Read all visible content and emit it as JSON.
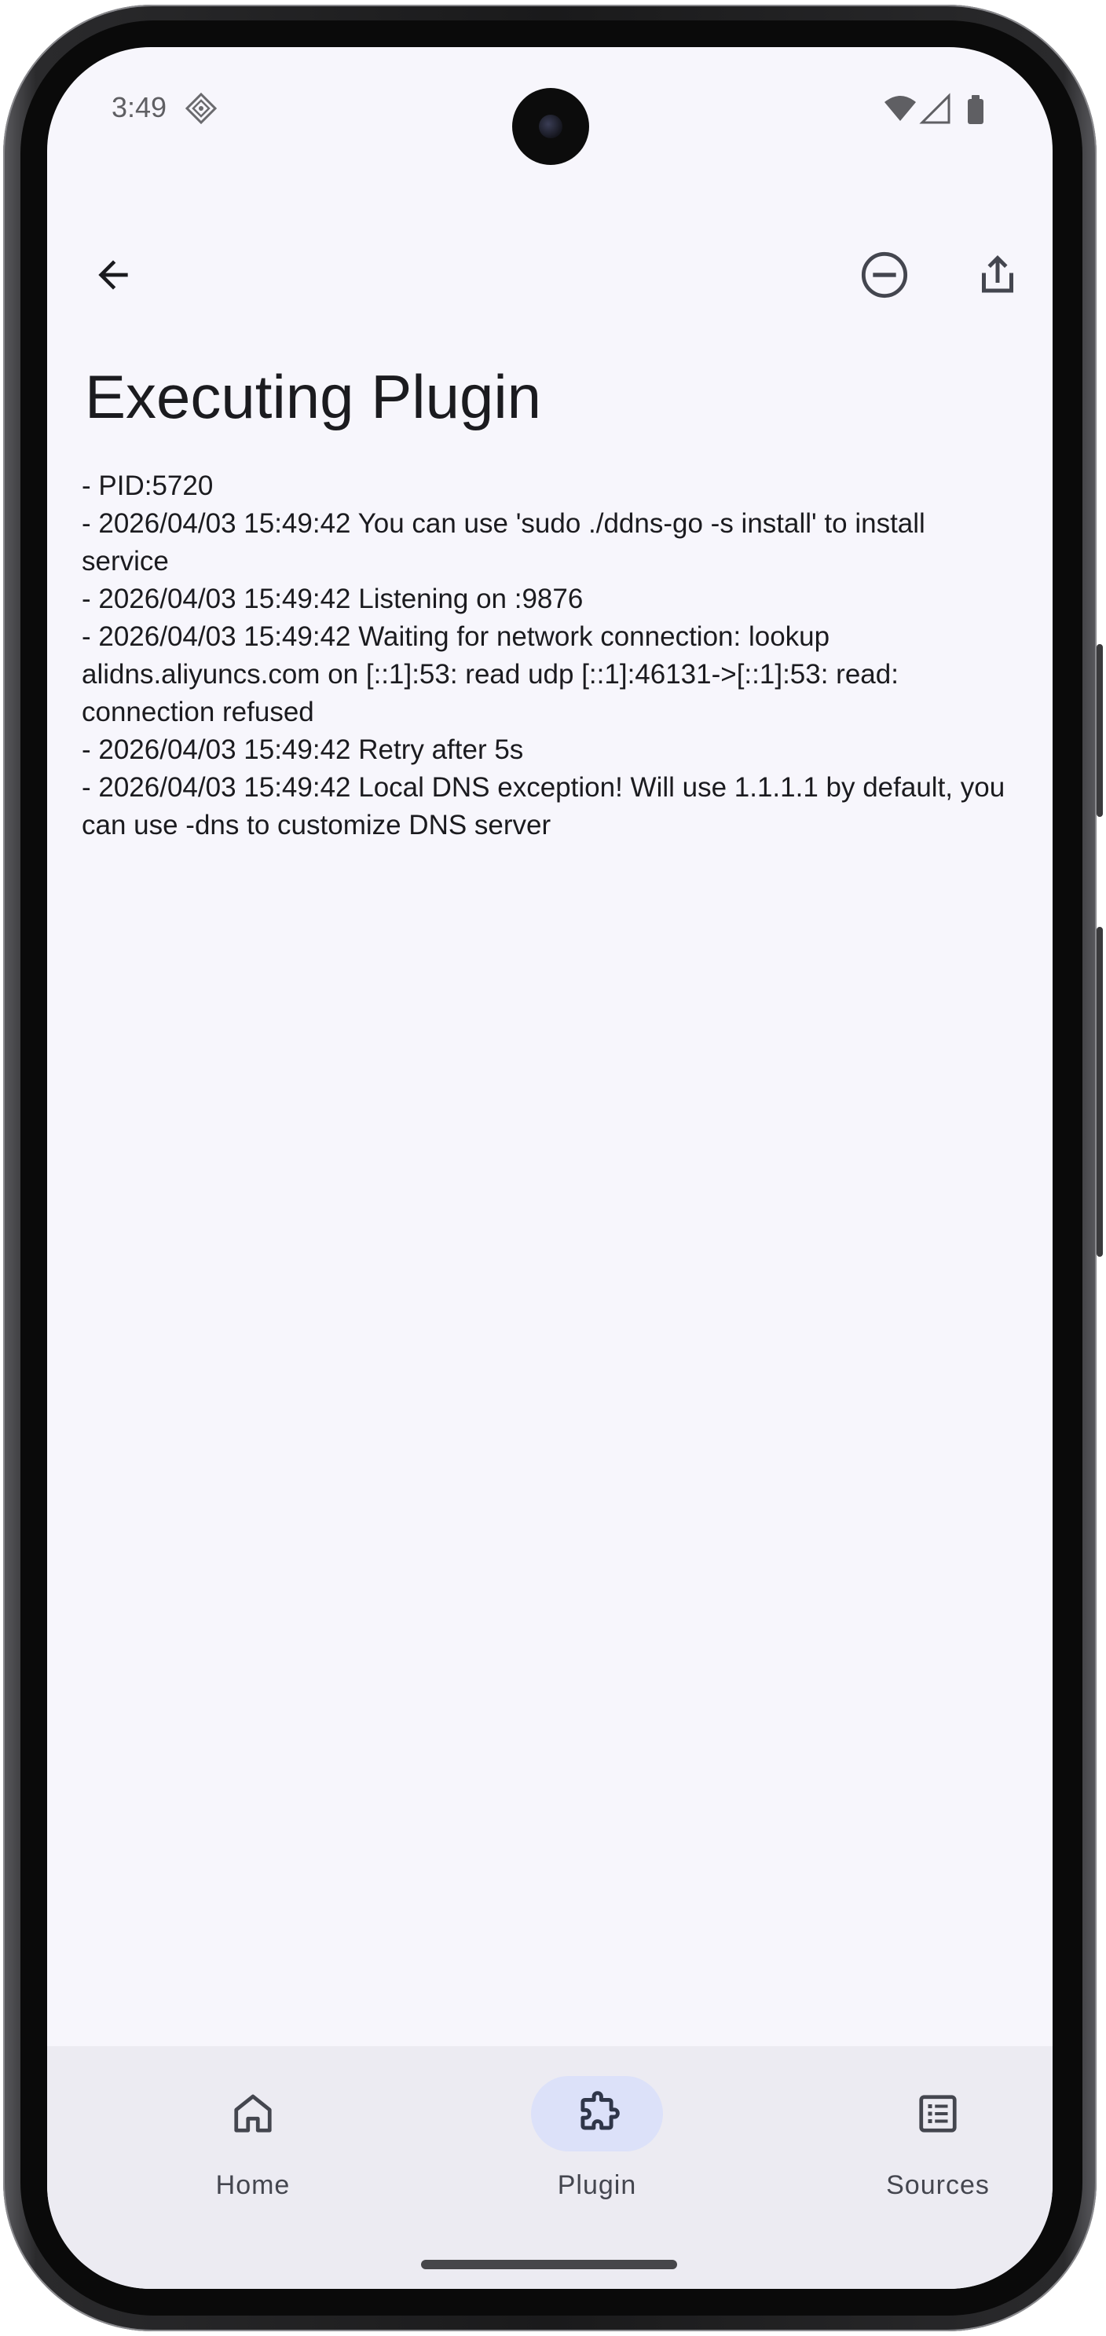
{
  "status_bar": {
    "time": "3:49"
  },
  "app_bar": {
    "back_icon": "arrow-left-icon",
    "stop_icon": "minus-circle-icon",
    "share_icon": "share-icon"
  },
  "page": {
    "title": "Executing Plugin"
  },
  "log": {
    "lines": [
      "- PID:5720",
      "- 2026/04/03 15:49:42 You can use 'sudo ./ddns-go -s install' to install service",
      "- 2026/04/03 15:49:42 Listening on :9876",
      "- 2026/04/03 15:49:42 Waiting for network connection: lookup alidns.aliyuncs.com on [::1]:53: read udp [::1]:46131->[::1]:53: read: connection refused",
      "- 2026/04/03 15:49:42 Retry after 5s",
      "- 2026/04/03 15:49:42 Local DNS exception! Will use 1.1.1.1 by default, you can use -dns to customize DNS server"
    ]
  },
  "bottom_nav": {
    "items": [
      {
        "label": "Home",
        "icon": "home-icon",
        "active": false
      },
      {
        "label": "Plugin",
        "icon": "puzzle-icon",
        "active": true
      },
      {
        "label": "Sources",
        "icon": "list-icon",
        "active": false
      }
    ]
  },
  "colors": {
    "background": "#f7f6fc",
    "nav_background": "#ecebf2",
    "active_pill": "#dce1f9",
    "text": "#1b1b1f"
  }
}
